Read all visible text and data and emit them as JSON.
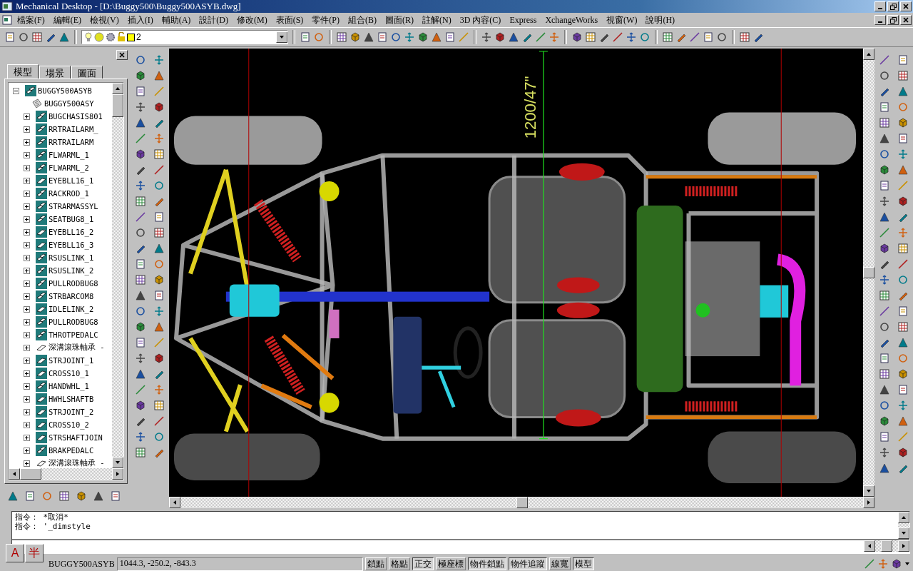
{
  "window": {
    "title": "Mechanical Desktop - [D:\\Buggy500\\Buggy500ASYB.dwg]"
  },
  "menu": [
    "檔案(F)",
    "編輯(E)",
    "檢視(V)",
    "插入(I)",
    "輔助(A)",
    "設計(D)",
    "修改(M)",
    "表面(S)",
    "零件(P)",
    "組合(B)",
    "圖面(R)",
    "註解(N)",
    "3D 內容(C)",
    "Express",
    "XchangeWorks",
    "視窗(W)",
    "說明(H)"
  ],
  "layer_toolbar": {
    "layer": "2"
  },
  "browser": {
    "tabs": [
      {
        "label": "模型",
        "selected": true
      },
      {
        "label": "場景",
        "selected": false
      },
      {
        "label": "圖面",
        "selected": false
      }
    ],
    "tree": {
      "label": "BUGGY500ASYB",
      "kind": "assembly",
      "expanded": true,
      "children": [
        {
          "label": "BUGGY500ASY",
          "kind": "drawing"
        },
        {
          "label": "BUGCHASIS801",
          "kind": "assembly",
          "expanded": false
        },
        {
          "label": "RRTRAILARM_",
          "kind": "assembly",
          "expanded": false
        },
        {
          "label": "RRTRAILARM",
          "kind": "assembly",
          "expanded": false
        },
        {
          "label": "FLWARML_1",
          "kind": "assembly",
          "expanded": false
        },
        {
          "label": "FLWARML_2",
          "kind": "assembly",
          "expanded": false
        },
        {
          "label": "EYEBLL16_1",
          "kind": "part",
          "expanded": false
        },
        {
          "label": "RACKROD_1",
          "kind": "assembly",
          "expanded": false
        },
        {
          "label": "STRARMASSYL",
          "kind": "assembly",
          "expanded": false
        },
        {
          "label": "SEATBUG8_1",
          "kind": "assembly",
          "expanded": false
        },
        {
          "label": "EYEBLL16_2",
          "kind": "part",
          "expanded": false
        },
        {
          "label": "EYEBLL16_3",
          "kind": "part",
          "expanded": false
        },
        {
          "label": "RSUSLINK_1",
          "kind": "assembly",
          "expanded": false
        },
        {
          "label": "RSUSLINK_2",
          "kind": "assembly",
          "expanded": false
        },
        {
          "label": "PULLRODBUG8",
          "kind": "assembly",
          "expanded": false
        },
        {
          "label": "STRBARCOM8",
          "kind": "assembly",
          "expanded": false
        },
        {
          "label": "IDLELINK_2",
          "kind": "part",
          "expanded": false
        },
        {
          "label": "PULLRODBUG8",
          "kind": "assembly",
          "expanded": false
        },
        {
          "label": "THROTPEDALC",
          "kind": "assembly",
          "expanded": false
        },
        {
          "label": "深溝滾珠軸承 -",
          "kind": "library_part",
          "expanded": false
        },
        {
          "label": "STRJOINT_1",
          "kind": "part",
          "expanded": false
        },
        {
          "label": "CROSS10_1",
          "kind": "part",
          "expanded": false
        },
        {
          "label": "HANDWHL_1",
          "kind": "assembly",
          "expanded": false
        },
        {
          "label": "HWHLSHAFTB",
          "kind": "part",
          "expanded": false
        },
        {
          "label": "STRJOINT_2",
          "kind": "part",
          "expanded": false
        },
        {
          "label": "CROSS10_2",
          "kind": "part",
          "expanded": false
        },
        {
          "label": "STRSHAFTJOIN",
          "kind": "part",
          "expanded": false
        },
        {
          "label": "BRAKPEDALC",
          "kind": "assembly",
          "expanded": false
        },
        {
          "label": "深溝滾珠軸承 -",
          "kind": "library_part",
          "expanded": false
        }
      ]
    }
  },
  "canvas": {
    "dimension": "1200/47\""
  },
  "command_line": {
    "history": [
      "指令： *取消*",
      "指令： '_dimstyle"
    ]
  },
  "ime": {
    "mode": "A",
    "width": "半"
  },
  "status_bar": {
    "target": "BUGGY500ASYB",
    "coordinates": "1044.3, -250.2, -843.3",
    "toggles": [
      {
        "label": "鎖點",
        "on": false
      },
      {
        "label": "格點",
        "on": false
      },
      {
        "label": "正交",
        "on": true
      },
      {
        "label": "極座標",
        "on": false
      },
      {
        "label": "物件鎖點",
        "on": true
      },
      {
        "label": "物件追蹤",
        "on": true
      },
      {
        "label": "線寬",
        "on": false
      },
      {
        "label": "模型",
        "on": true
      }
    ]
  }
}
